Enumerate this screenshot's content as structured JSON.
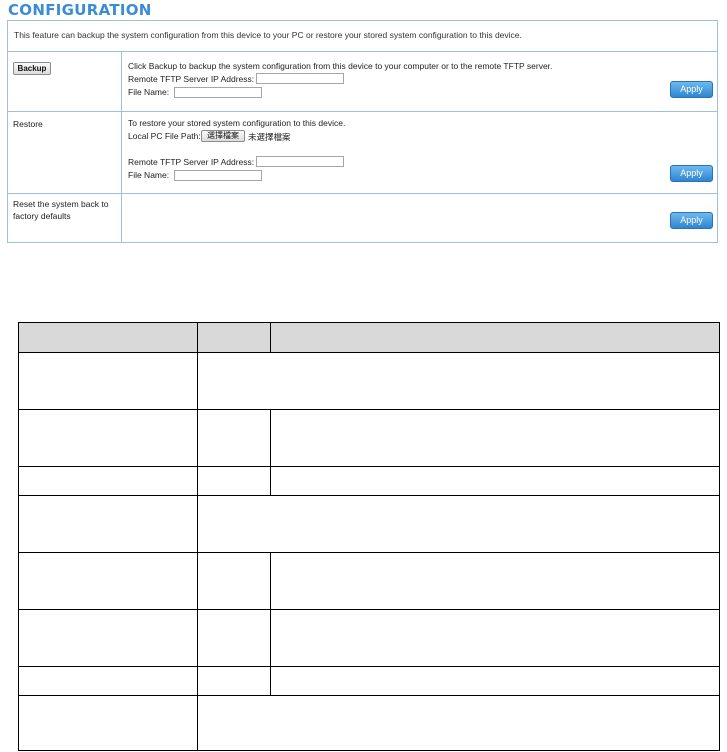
{
  "header": {
    "title": "CONFIGURATION"
  },
  "config": {
    "intro": "This feature can backup the system configuration from this device to your PC or restore your stored system configuration to this device.",
    "backup": {
      "button_label": "Backup",
      "description": "Click Backup to backup the system configuration from this device to your computer or to the remote TFTP server.",
      "tftp_label": "Remote TFTP Server IP Address:",
      "tftp_value": "",
      "filename_label": "File Name:",
      "filename_value": "",
      "apply_label": "Apply"
    },
    "restore": {
      "label": "Restore",
      "description": "To restore your stored system configuration to this device.",
      "local_path_label": "Local PC File Path:",
      "choose_file_label": "選擇檔案",
      "no_file_text": "未選擇檔案",
      "tftp_label": "Remote TFTP Server IP Address:",
      "tftp_value": "",
      "filename_label": "File Name:",
      "filename_value": "",
      "apply_label": "Apply"
    },
    "reset": {
      "label": "Reset the system back to factory defaults",
      "apply_label": "Apply"
    }
  },
  "colors": {
    "title": "#3b8bd6",
    "border": "#9fc1de",
    "apply_button": "#3d92da",
    "table_header": "#d9d9d9"
  }
}
